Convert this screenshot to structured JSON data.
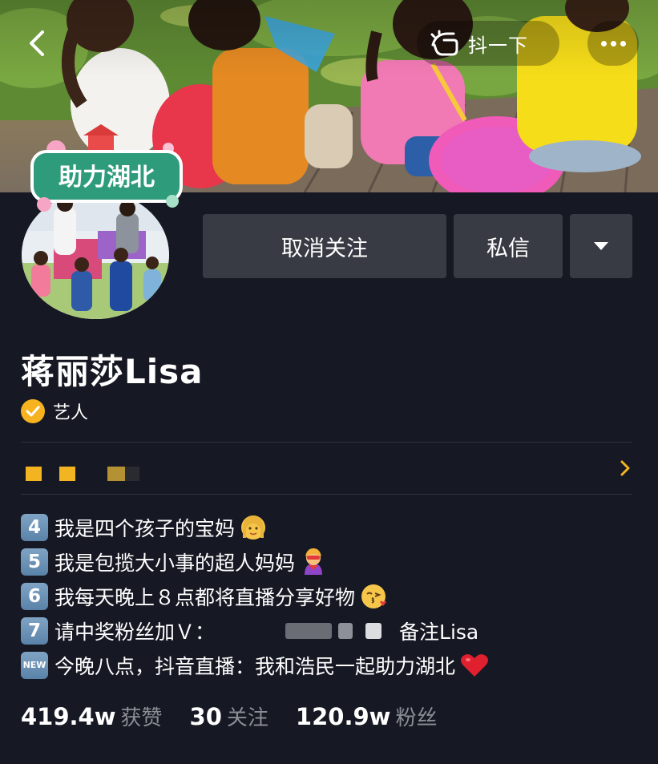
{
  "header": {
    "shake_label": "抖一下",
    "cover_badge_text": "助力湖北"
  },
  "actions": {
    "unfollow_label": "取消关注",
    "message_label": "私信"
  },
  "profile": {
    "name": "蒋丽莎Lisa",
    "verification_label": "艺人"
  },
  "bio": [
    {
      "key": "4",
      "text": "我是四个孩子的宝妈",
      "emoji": "woman-icon"
    },
    {
      "key": "5",
      "text": "我是包揽大小事的超人妈妈",
      "emoji": "superhero-icon"
    },
    {
      "key": "6",
      "text": "我每天晚上８点都将直播分享好物",
      "emoji": "kiss-face-icon"
    },
    {
      "key": "7",
      "text_before": "请中奖粉丝加Ｖ：",
      "text_after": "备注Lisa",
      "emoji": ""
    },
    {
      "key": "NEW",
      "text": "今晚八点，抖音直播：我和浩民一起助力湖北",
      "emoji": "red-heart-icon"
    }
  ],
  "stats": [
    {
      "value": "419.4w",
      "label": "获赞"
    },
    {
      "value": "30",
      "label": "关注"
    },
    {
      "value": "120.9w",
      "label": "粉丝"
    }
  ],
  "colors": {
    "background": "#161823",
    "button": "#393b44",
    "accent_yellow": "#f2b521",
    "secondary_text": "#8c8e96"
  }
}
